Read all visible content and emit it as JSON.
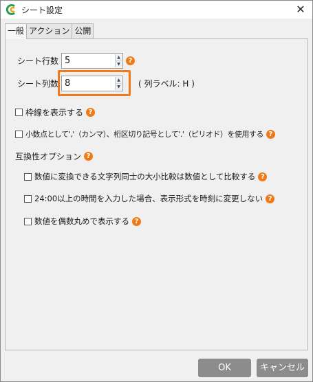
{
  "window": {
    "title": "シート設定",
    "close_glyph": "✕"
  },
  "tabs": [
    {
      "label": "一般",
      "active": true
    },
    {
      "label": "アクション",
      "active": false
    },
    {
      "label": "公開",
      "active": false
    }
  ],
  "sheet_rows": {
    "label": "シート行数",
    "value": "5"
  },
  "sheet_cols": {
    "label": "シート列数",
    "value": "8",
    "note": "( 列ラベル: H )"
  },
  "options": {
    "grid_lines": {
      "label": "枠線を表示する",
      "checked": false
    },
    "decimal": {
      "label": "小数点として','（カンマ）、桁区切り記号として'.'（ピリオド）を使用する",
      "checked": false
    }
  },
  "compat": {
    "heading": "互換性オプション",
    "items": [
      {
        "label": "数値に変換できる文字列同士の大小比較は数値として比較する",
        "checked": false
      },
      {
        "label": "24:00以上の時間を入力した場合、表示形式を時刻に変更しない",
        "checked": false
      },
      {
        "label": "数値を偶数丸めで表示する",
        "checked": false
      }
    ]
  },
  "buttons": {
    "ok": "OK",
    "cancel": "キャンセル"
  },
  "help_glyph": "?",
  "colors": {
    "accent": "#f07b1e",
    "help": "#ef7a16",
    "button": "#8c8c8c"
  }
}
